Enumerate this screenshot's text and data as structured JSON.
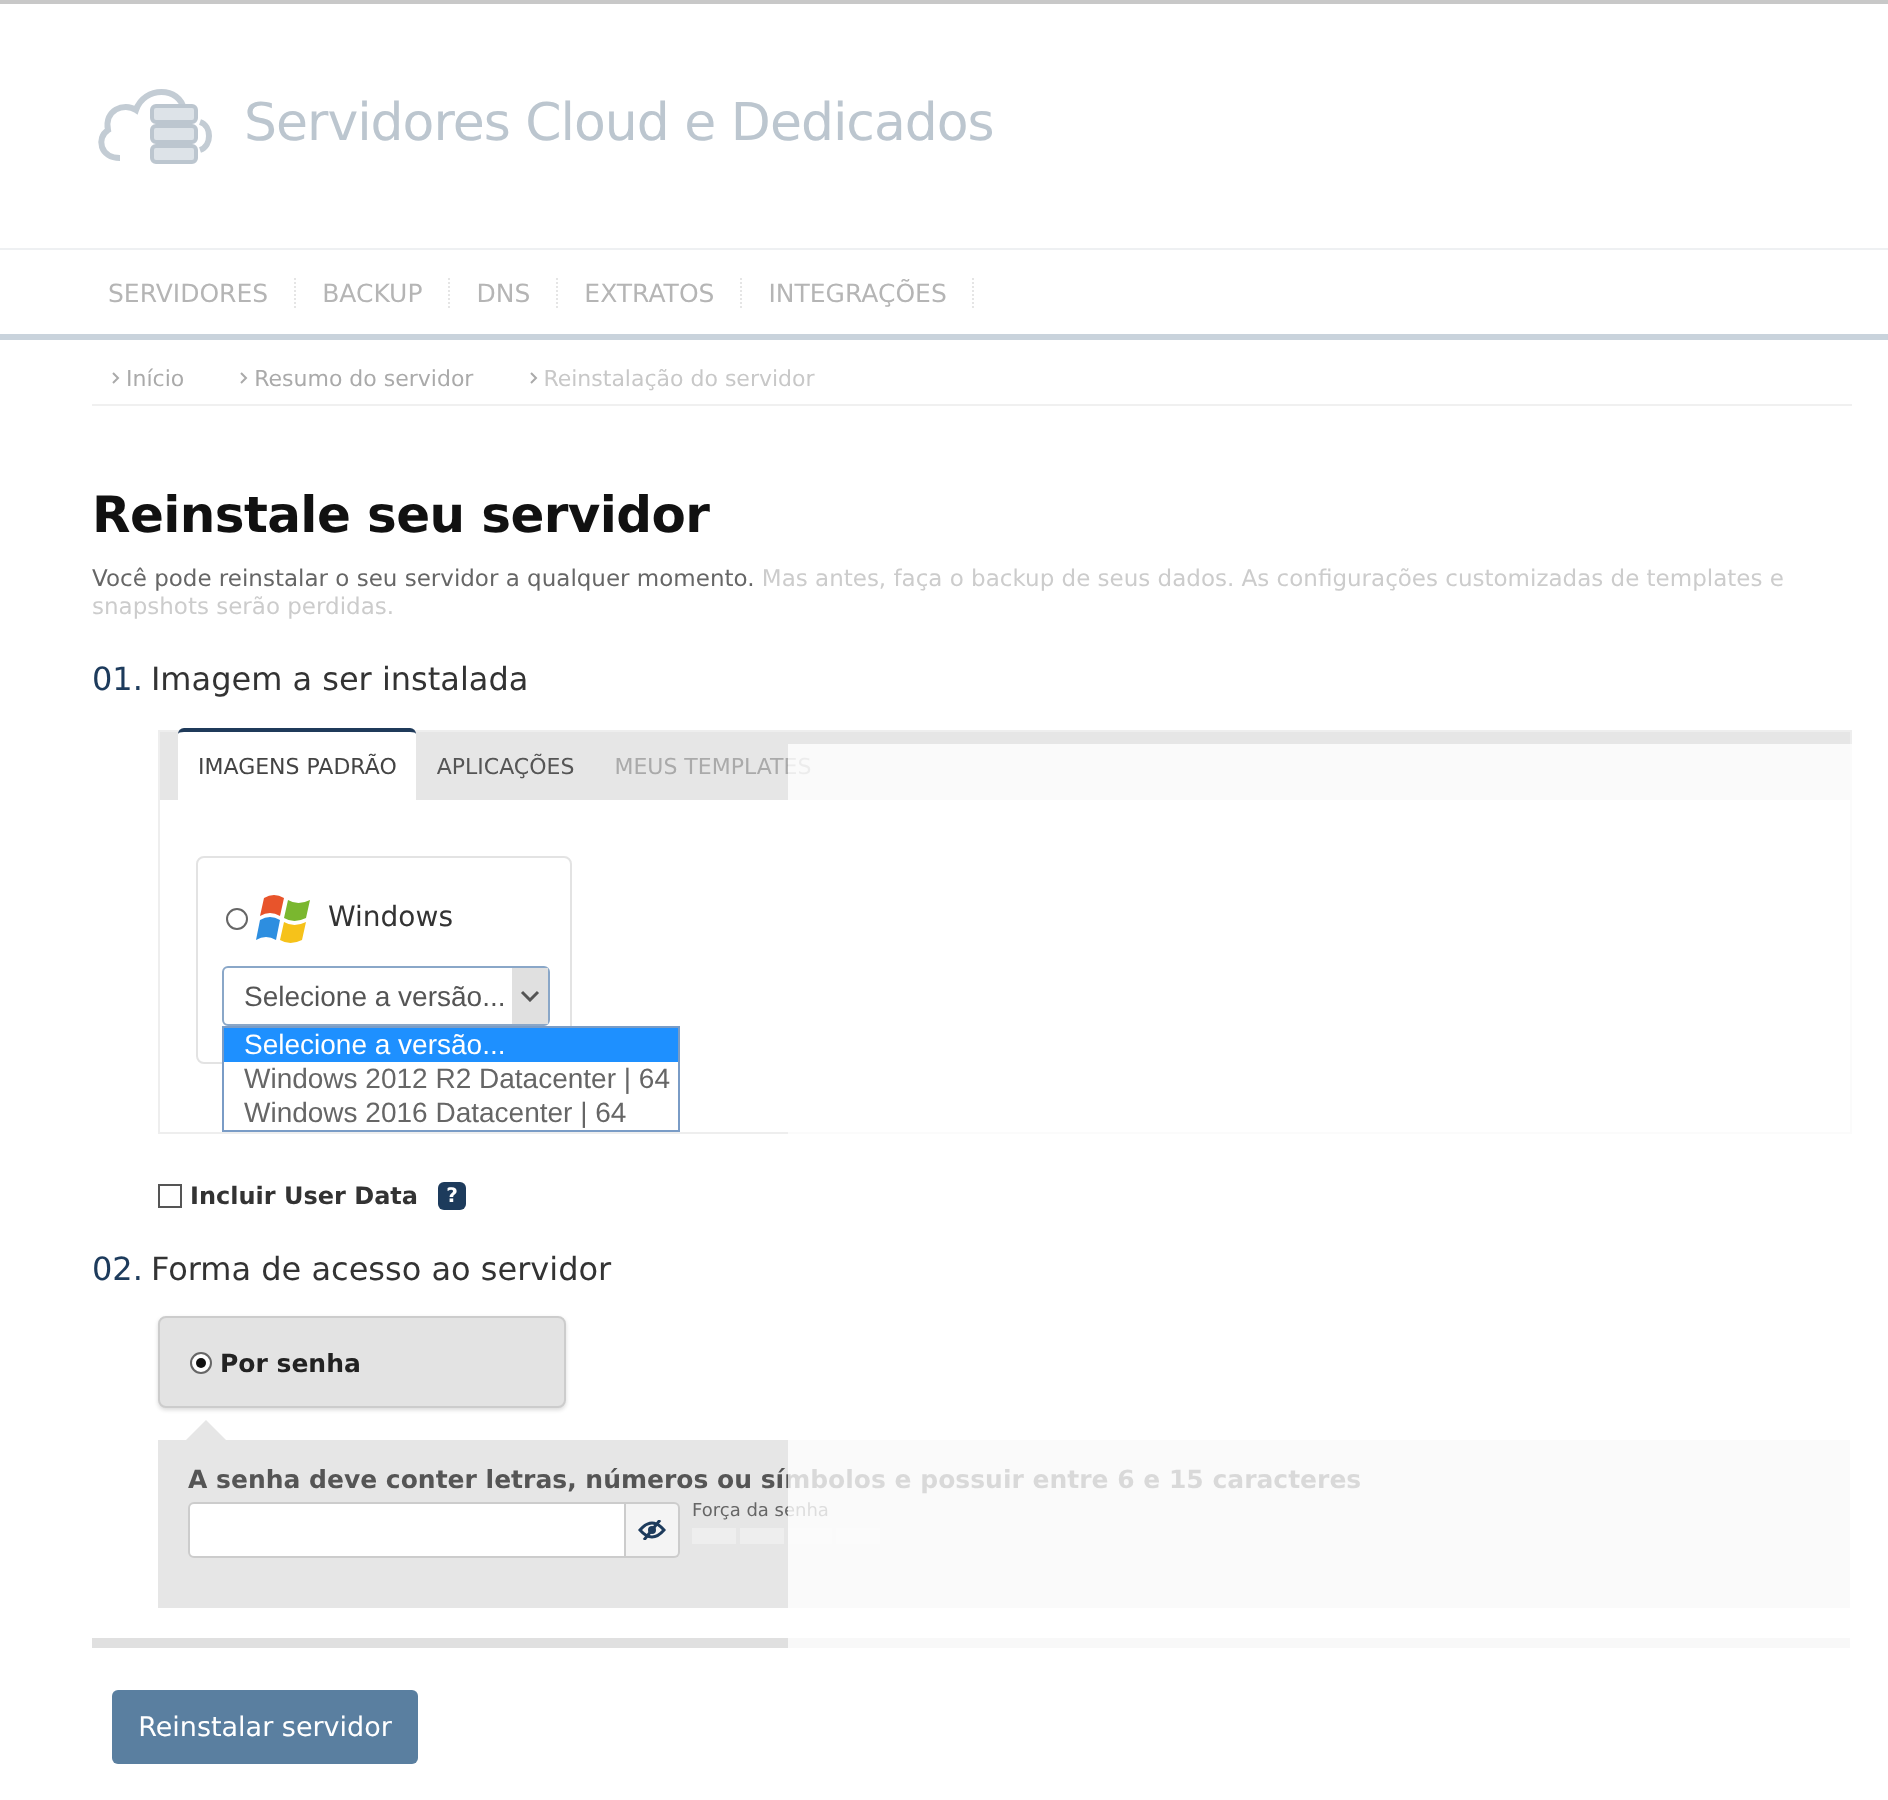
{
  "header": {
    "title": "Servidores Cloud e Dedicados"
  },
  "nav": [
    {
      "label": "SERVIDORES"
    },
    {
      "label": "BACKUP"
    },
    {
      "label": "DNS"
    },
    {
      "label": "EXTRATOS"
    },
    {
      "label": "INTEGRAÇÕES"
    }
  ],
  "breadcrumb": [
    {
      "label": "Início",
      "current": false
    },
    {
      "label": "Resumo do servidor",
      "current": false
    },
    {
      "label": "Reinstalação do servidor",
      "current": true
    }
  ],
  "page": {
    "title": "Reinstale seu servidor",
    "intro": "Você pode reinstalar o seu servidor a qualquer momento.",
    "note": "Mas antes, faça o backup de seus dados. As configurações customizadas de templates e snapshots serão perdidas."
  },
  "section_1": {
    "number": "01.",
    "title": "Imagem a ser instalada",
    "tabs": [
      {
        "label": "IMAGENS PADRÃO",
        "selected": true
      },
      {
        "label": "APLICAÇÕES",
        "selected": false
      },
      {
        "label": "MEUS TEMPLATES",
        "selected": false
      }
    ],
    "image": {
      "name": "Windows",
      "selected": false,
      "version_select": {
        "value": "Selecione a versão...",
        "expanded": true,
        "options": [
          {
            "label": "Selecione a versão...",
            "selected": true
          },
          {
            "label": "Windows 2012 R2 Datacenter | 64",
            "selected": false
          },
          {
            "label": "Windows 2016 Datacenter | 64",
            "selected": false
          }
        ]
      }
    },
    "user_data": {
      "label": "Incluir User Data",
      "checked": false,
      "help": "?"
    }
  },
  "section_2": {
    "number": "02.",
    "title": "Forma de acesso ao servidor",
    "options": [
      {
        "label": "Por senha",
        "selected": true
      }
    ],
    "password": {
      "hint": "A senha deve conter letras, números ou símbolos e possuir entre 6 e 15 caracteres",
      "strength_label": "Força da senha"
    }
  },
  "submit": {
    "label": "Reinstalar servidor"
  }
}
